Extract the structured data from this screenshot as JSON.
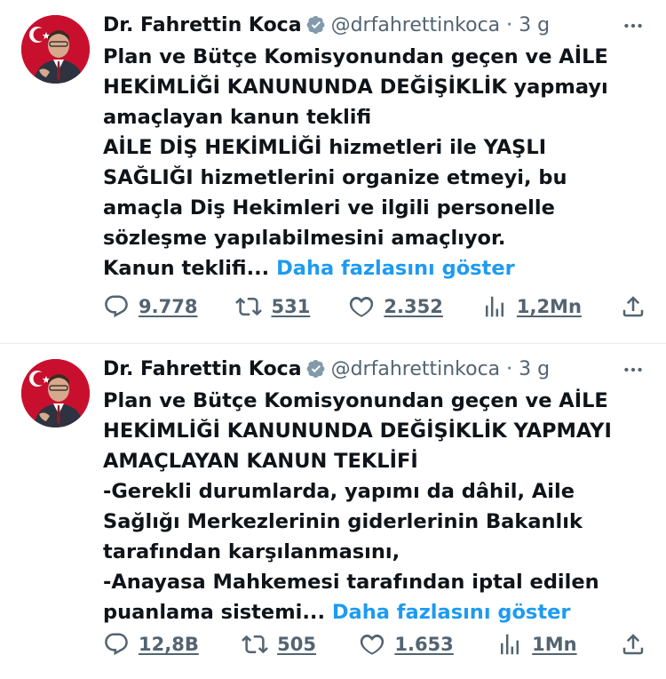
{
  "tweets": [
    {
      "author": {
        "name": "Dr. Fahrettin Koca",
        "handle": "@drfahrettinkoca",
        "separator": "·",
        "time": "3 g"
      },
      "lines": [
        "Plan ve Bütçe Komisyonundan geçen ve AİLE",
        "HEKİMLİĞİ KANUNUNDA DEĞİŞİKLİK yapmayı",
        "amaçlayan kanun teklifi",
        "AİLE DİŞ HEKİMLİĞİ hizmetleri ile YAŞLI",
        "SAĞLIĞI hizmetlerini organize etmeyi, bu",
        "amaçla Diş Hekimleri ve ilgili personelle",
        "sözleşme yapılabilmesini amaçlıyor."
      ],
      "last_line": "Kanun teklifi...",
      "show_more": "Daha fazlasını göster",
      "stats": {
        "replies": "9.778",
        "reposts": "531",
        "likes": "2.352",
        "views": "1,2Mn"
      }
    },
    {
      "author": {
        "name": "Dr. Fahrettin Koca",
        "handle": "@drfahrettinkoca",
        "separator": "·",
        "time": "3 g"
      },
      "lines": [
        "Plan ve Bütçe Komisyonundan geçen ve AİLE",
        "HEKİMLİĞİ KANUNUNDA DEĞİŞİKLİK YAPMAYI",
        "AMAÇLAYAN KANUN TEKLİFİ",
        "-Gerekli durumlarda, yapımı da dâhil, Aile",
        "Sağlığı Merkezlerinin giderlerinin Bakanlık",
        "tarafından karşılanmasını,",
        "-Anayasa Mahkemesi tarafından iptal edilen"
      ],
      "last_line": "puanlama sistemi...",
      "show_more": "Daha fazlasını göster",
      "stats": {
        "replies": "12,8B",
        "reposts": "505",
        "likes": "1.653",
        "views": "1Mn"
      }
    }
  ],
  "icons": {
    "verified": "verified-badge-icon",
    "more": "more-options-icon",
    "reply": "reply-icon",
    "repost": "repost-icon",
    "like": "like-icon",
    "views": "views-icon",
    "share": "share-icon"
  },
  "colors": {
    "link": "#1d9bf0",
    "muted": "#536471",
    "text": "#0f1419",
    "verified": "#1d9bf0"
  }
}
